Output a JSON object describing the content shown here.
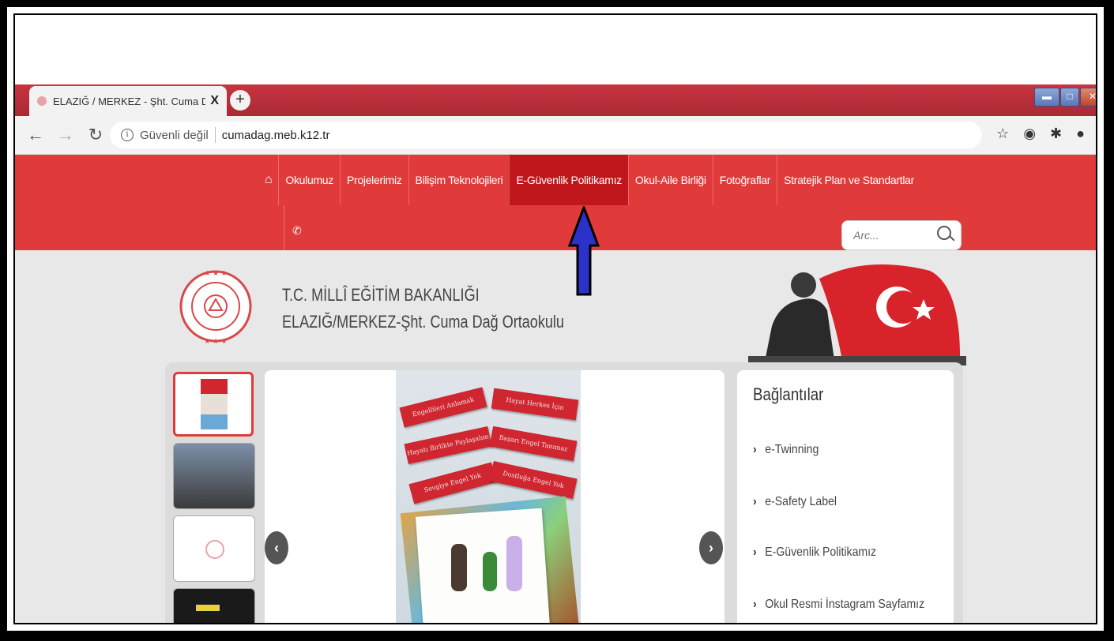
{
  "browser": {
    "tab_title": "ELAZIĞ / MERKEZ - Şht. Cuma Da",
    "tab_close": "X",
    "new_tab": "+",
    "security_label": "Güvenli değil",
    "url": "cumadag.meb.k12.tr"
  },
  "site": {
    "nav": {
      "items": [
        "Okulumuz",
        "Projelerimiz",
        "Bilişim Teknolojileri",
        "E-Güvenlik Politikamız",
        "Okul-Aile Birliği",
        "Fotoğraflar",
        "Stratejik Plan ve Standartlar"
      ],
      "active": "E-Güvenlik Politikamız"
    },
    "search_placeholder": "Arc...",
    "org_line1": "T.C. MİLLÎ EĞİTİM BAKANLIĞI",
    "org_line2": "ELAZIĞ/MERKEZ-Şht. Cuma Dağ Ortaokulu",
    "slide_labels": [
      "Engellileri Anlamak",
      "Hayat Herkes İçin",
      "Hayatı Birlikte Paylaşalım",
      "Başarı Engel Tanımaz",
      "Sevgiye Engel Yok",
      "Dostluğa Engel Yok"
    ],
    "links": {
      "title": "Bağlantılar",
      "items": [
        "e-Twinning",
        "e-Safety Label",
        "E-Güvenlik Politikamız",
        "Okul Resmi İnstagram Sayfamız"
      ]
    }
  },
  "colors": {
    "nav_red": "#e03a3a",
    "nav_active": "#c0171d",
    "annotation_arrow": "#2c32c9"
  }
}
